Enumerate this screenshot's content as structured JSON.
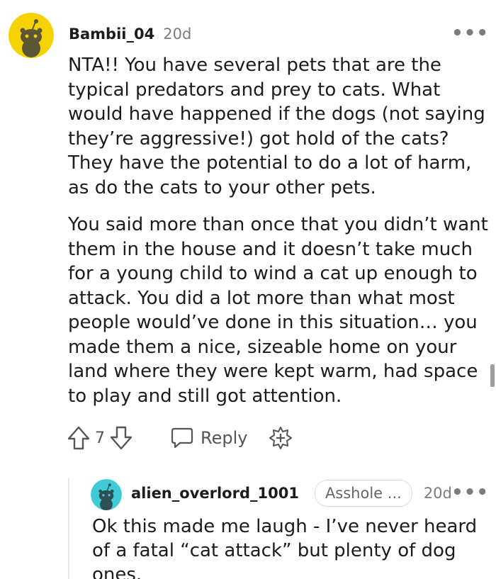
{
  "comment": {
    "author": "Bambii_04",
    "age": "20d",
    "more": "•••",
    "paragraphs": [
      "NTA!! You have several pets that are the typical predators and prey to cats. What would have happened if the dogs (not saying they’re aggressive!) got hold of the cats? They have the potential to do a lot of harm, as do the cats to your other pets.",
      "You said more than once that you didn’t want them in the house and it doesn’t take much for a young child to wind a cat up enough to attack. You did a lot more than what most people would’ve done in this situation… you made them a nice, sizeable home on your land where they were kept warm, had space to play and still got attention."
    ],
    "avatar_color": "#f5d200",
    "actions": {
      "vote_count": "7",
      "reply_label": "Reply"
    }
  },
  "reply": {
    "author": "alien_overlord_1001",
    "flair": "Asshole ...",
    "age": "20d",
    "more": "•••",
    "text": "Ok this made me laugh - I’ve never heard of a fatal “cat attack” but plenty of dog ones.",
    "avatar_color": "#3ecbd6"
  },
  "icons": [
    "snoo-avatar-icon",
    "upvote-icon",
    "downvote-icon",
    "reply-icon",
    "award-icon",
    "more-icon"
  ]
}
